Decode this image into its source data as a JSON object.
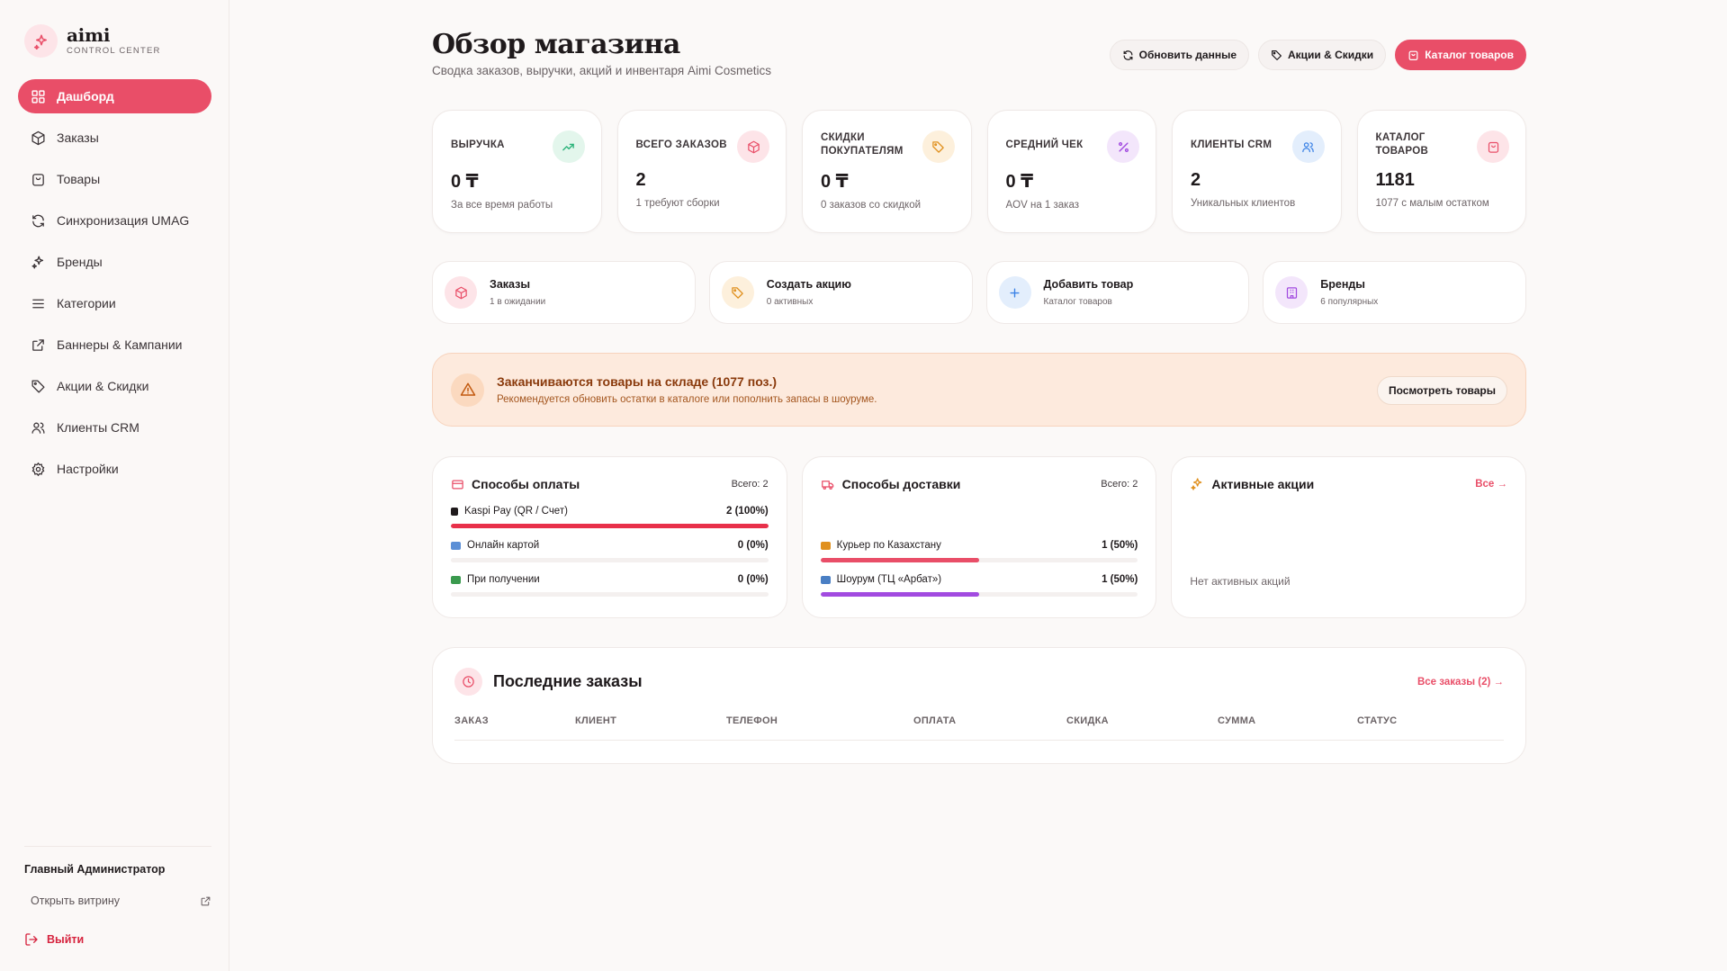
{
  "brand": {
    "name": "aimi",
    "subtitle": "CONTROL CENTER",
    "accent": "#e94e68"
  },
  "sidebar": {
    "items": [
      {
        "label": "Дашборд",
        "icon": "dashboard-icon",
        "active": true
      },
      {
        "label": "Заказы",
        "icon": "box-icon"
      },
      {
        "label": "Товары",
        "icon": "bag-icon"
      },
      {
        "label": "Синхронизация UMAG",
        "icon": "sync-icon"
      },
      {
        "label": "Бренды",
        "icon": "sparkle-icon"
      },
      {
        "label": "Категории",
        "icon": "list-icon"
      },
      {
        "label": "Баннеры & Кампании",
        "icon": "external-icon"
      },
      {
        "label": "Акции & Скидки",
        "icon": "tag-icon"
      },
      {
        "label": "Клиенты CRM",
        "icon": "users-icon"
      },
      {
        "label": "Настройки",
        "icon": "gear-icon"
      }
    ],
    "admin": "Главный Администратор",
    "storefront_link": "Открыть витрину",
    "logout": "Выйти"
  },
  "header": {
    "title": "Обзор магазина",
    "subtitle": "Сводка заказов, выручки, акций и инвентаря Aimi Cosmetics",
    "refresh": "Обновить данные",
    "promos": "Акции & Скидки",
    "catalog": "Каталог товаров"
  },
  "stats": [
    {
      "label": "Выручка",
      "value": "0 ₸",
      "caption": "За все время работы",
      "icon": "trend-up-icon",
      "color": "#2bb37a"
    },
    {
      "label": "Всего заказов",
      "value": "2",
      "caption": "1 требуют сборки",
      "icon": "box-icon",
      "color": "#e94e68"
    },
    {
      "label": "Скидки покупателям",
      "value": "0 ₸",
      "caption": "0 заказов со скидкой",
      "icon": "tag-icon",
      "color": "#e0901e"
    },
    {
      "label": "Средний чек",
      "value": "0 ₸",
      "caption": "AOV на 1 заказ",
      "icon": "percent-icon",
      "color": "#a24be0"
    },
    {
      "label": "Клиенты CRM",
      "value": "2",
      "caption": "Уникальных клиентов",
      "icon": "users-icon",
      "color": "#3b82e6"
    },
    {
      "label": "Каталог товаров",
      "value": "1181",
      "caption": "1077 с малым остатком",
      "icon": "bag-icon",
      "color": "#e94e68"
    }
  ],
  "quick": [
    {
      "title": "Заказы",
      "sub": "1 в ожидании",
      "icon": "box-icon"
    },
    {
      "title": "Создать акцию",
      "sub": "0 активных",
      "icon": "tag-icon"
    },
    {
      "title": "Добавить товар",
      "sub": "Каталог товаров",
      "icon": "plus-icon"
    },
    {
      "title": "Бренды",
      "sub": "6 популярных",
      "icon": "building-icon"
    }
  ],
  "alert": {
    "title": "Заканчиваются товары на складе (1077 поз.)",
    "sub": "Рекомендуется обновить остатки в каталоге или пополнить запасы в шоуруме.",
    "button": "Посмотреть товары"
  },
  "payments": {
    "title": "Способы оплаты",
    "total": "Всего: 2",
    "rows": [
      {
        "name": "Kaspi Pay (QR / Счет)",
        "value": "2 (100%)",
        "share": 1.0,
        "color": "#e8304a"
      },
      {
        "name": "Онлайн картой",
        "value": "0 (0%)",
        "share": 0,
        "color": "#e8304a"
      },
      {
        "name": "При получении",
        "value": "0 (0%)",
        "share": 0,
        "color": "#e8304a"
      }
    ]
  },
  "delivery": {
    "title": "Способы доставки",
    "total": "Всего: 2",
    "rows": [
      {
        "name": "Курьер по Казахстану",
        "value": "1 (50%)",
        "share": 0.5,
        "color": "#e94e68"
      },
      {
        "name": "Шоурум (ТЦ «Арбат»)",
        "value": "1 (50%)",
        "share": 0.5,
        "color": "#a24be0"
      }
    ]
  },
  "active_promos": {
    "title": "Активные акции",
    "link": "Все →",
    "empty": "Нет активных акций"
  },
  "orders": {
    "title": "Последние заказы",
    "link": "Все заказы (2) →",
    "columns": [
      "Заказ",
      "Клиент",
      "Телефон",
      "Оплата",
      "Скидка",
      "Сумма",
      "Статус"
    ]
  }
}
